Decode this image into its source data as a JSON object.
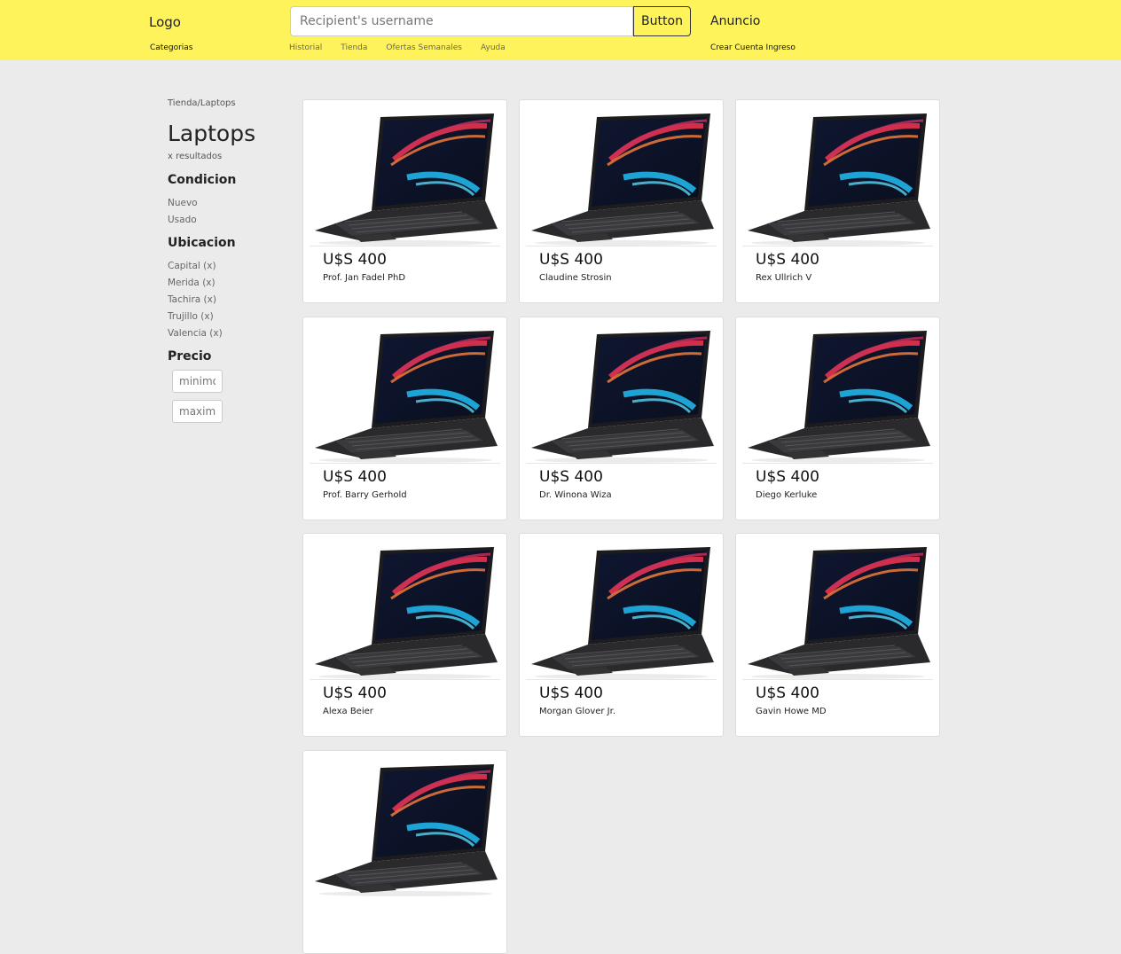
{
  "header": {
    "logo": "Logo",
    "categorias": "Categorias",
    "search_placeholder": "Recipient's username",
    "search_button": "Button",
    "nav": [
      "Historial",
      "Tienda",
      "Ofertas Semanales",
      "Ayuda"
    ],
    "anuncio": "Anuncio",
    "account": "Crear Cuenta Ingreso"
  },
  "sidebar": {
    "breadcrumb": "Tienda/Laptops",
    "title": "Laptops",
    "results": "x resultados",
    "condicion": {
      "heading": "Condicion",
      "items": [
        "Nuevo",
        "Usado"
      ]
    },
    "ubicacion": {
      "heading": "Ubicacion",
      "items": [
        "Capital (x)",
        "Merida (x)",
        "Tachira (x)",
        "Trujillo (x)",
        "Valencia (x)"
      ]
    },
    "precio": {
      "heading": "Precio",
      "min_placeholder": "minimo",
      "max_placeholder": "maximo"
    }
  },
  "products": [
    {
      "price": "U$S 400",
      "seller": "Prof. Jan Fadel PhD"
    },
    {
      "price": "U$S 400",
      "seller": "Claudine Strosin"
    },
    {
      "price": "U$S 400",
      "seller": "Rex Ullrich V"
    },
    {
      "price": "U$S 400",
      "seller": "Prof. Barry Gerhold"
    },
    {
      "price": "U$S 400",
      "seller": "Dr. Winona Wiza"
    },
    {
      "price": "U$S 400",
      "seller": "Diego Kerluke"
    },
    {
      "price": "U$S 400",
      "seller": "Alexa Beier"
    },
    {
      "price": "U$S 400",
      "seller": "Morgan Glover Jr."
    },
    {
      "price": "U$S 400",
      "seller": "Gavin Howe MD"
    }
  ],
  "colors": {
    "header_bg": "#fff35c",
    "page_bg": "#ebebeb"
  }
}
